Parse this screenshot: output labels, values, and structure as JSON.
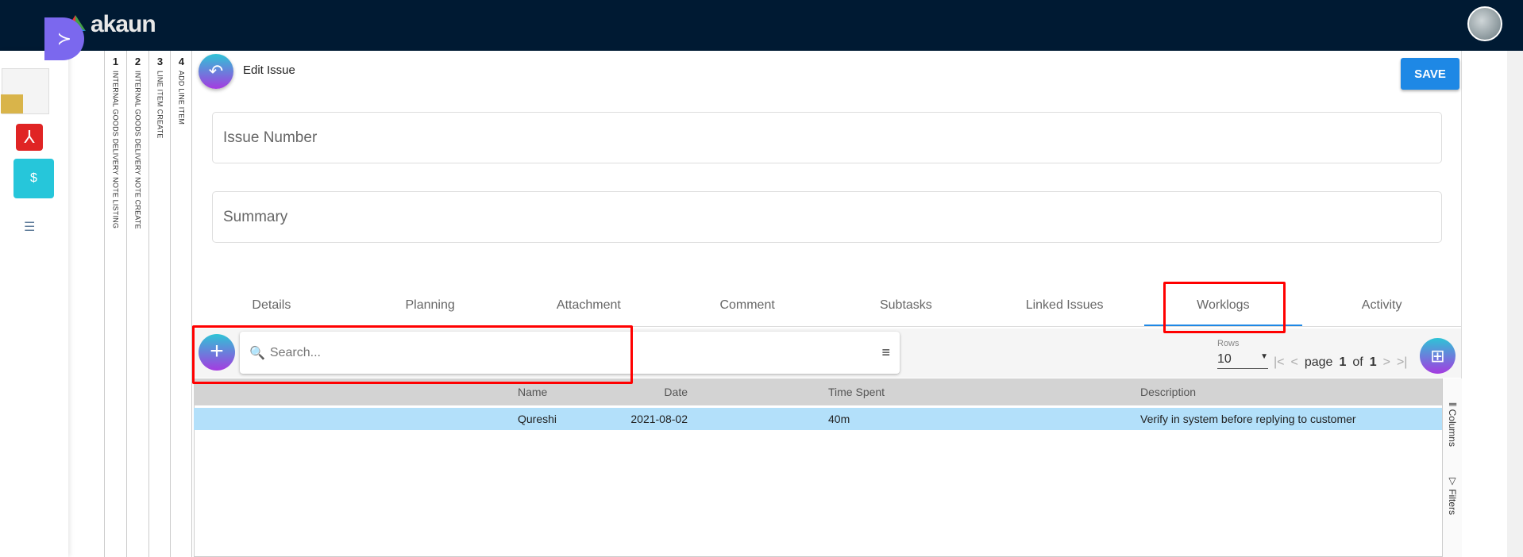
{
  "header": {
    "logo": "akaun"
  },
  "stepper": [
    {
      "n": "1",
      "label": "INTERNAL GOODS DELIVERY NOTE LISTING"
    },
    {
      "n": "2",
      "label": "INTERNAL GOODS DELIVERY NOTE CREATE"
    },
    {
      "n": "3",
      "label": "LINE ITEM CREATE"
    },
    {
      "n": "4",
      "label": "ADD LINE ITEM"
    }
  ],
  "page": {
    "title": "Edit Issue",
    "save": "SAVE"
  },
  "fields": {
    "issue_number": "Issue Number",
    "summary": "Summary"
  },
  "tabs": [
    "Details",
    "Planning",
    "Attachment",
    "Comment",
    "Subtasks",
    "Linked Issues",
    "Worklogs",
    "Activity"
  ],
  "toolbar": {
    "search_placeholder": "Search...",
    "rows_label": "Rows",
    "rows_value": "10",
    "page_word": "page",
    "page": "1",
    "of": "of",
    "total": "1"
  },
  "table": {
    "headers": [
      "Date",
      "Name",
      "Time Spent",
      "Description"
    ],
    "rows": [
      [
        "2021-08-02",
        "Qureshi",
        "40m",
        "Verify in system before replying to customer"
      ]
    ]
  },
  "side_panel": {
    "columns": "Columns",
    "filters": "Filters"
  }
}
